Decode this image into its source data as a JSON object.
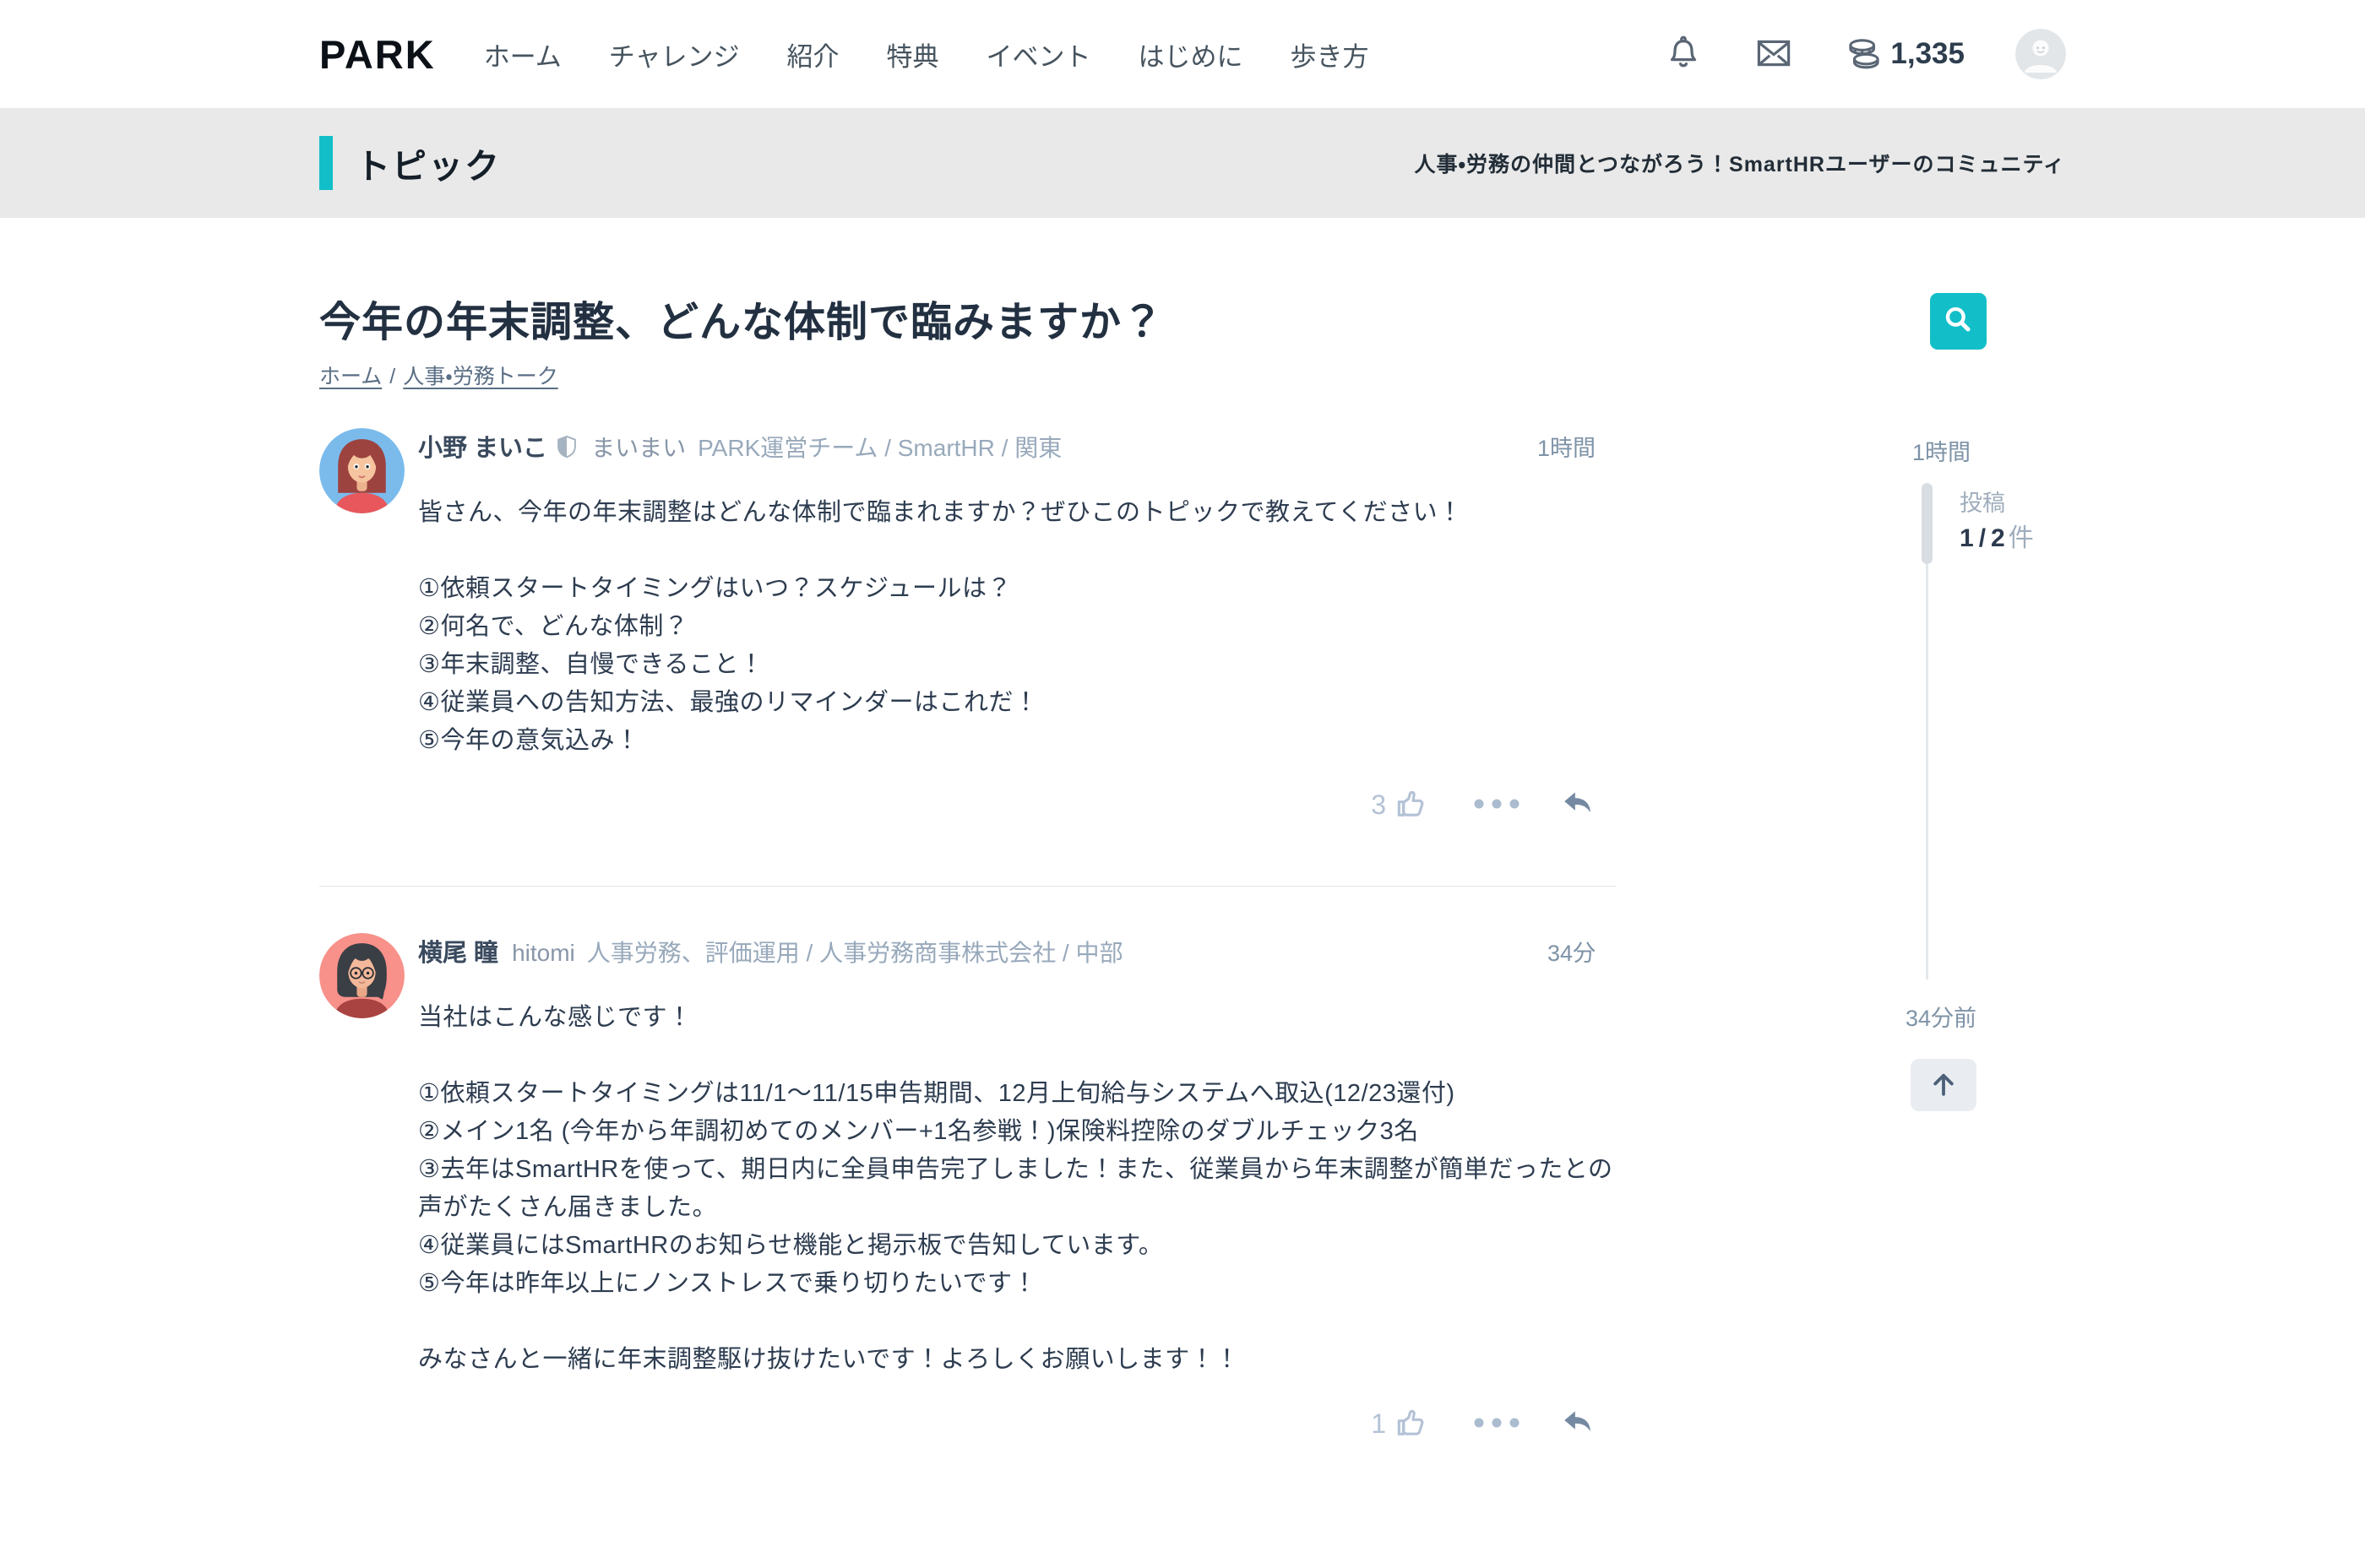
{
  "colors": {
    "accent": "#12bfc9",
    "topicbar_bg": "#e9e9e9"
  },
  "header": {
    "logo": "PARK",
    "nav": [
      "ホーム",
      "チャレンジ",
      "紹介",
      "特典",
      "イベント",
      "はじめに",
      "歩き方"
    ],
    "coin_count": "1,335"
  },
  "topicbar": {
    "label": "トピック",
    "tagline": "人事・労務の仲間とつながろう！SmartHRユーザーのコミュニティ"
  },
  "page": {
    "title": "今年の年末調整、どんな体制で臨みますか？",
    "breadcrumbs": [
      {
        "label": "ホーム"
      },
      {
        "label": "人事・労務トーク"
      }
    ],
    "breadcrumb_separator": "/"
  },
  "posts": [
    {
      "author": "小野 まいこ",
      "nickname": "まいまい",
      "meta": "PARK運営チーム / SmartHR / 関東",
      "time": "1時間",
      "likes": "3",
      "body": "皆さん、今年の年末調整はどんな体制で臨まれますか？ぜひこのトピックで教えてください！\n\n①依頼スタートタイミングはいつ？スケジュールは？\n②何名で、どんな体制？\n③年末調整、自慢できること！\n④従業員への告知方法、最強のリマインダーはこれだ！\n⑤今年の意気込み！"
    },
    {
      "author": "横尾 瞳",
      "nickname": "hitomi",
      "meta": "人事労務、評価運用 / 人事労務商事株式会社 / 中部",
      "time": "34分",
      "likes": "1",
      "body": "当社はこんな感じです！\n\n①依頼スタートタイミングは11/1〜11/15申告期間、12月上旬給与システムへ取込(12/23還付)\n②メイン1名 (今年から年調初めてのメンバー+1名参戦！)保険料控除のダブルチェック3名\n③去年はSmartHRを使って、期日内に全員申告完了しました！また、従業員から年末調整が簡単だったとの声がたくさん届きました。\n④従業員にはSmartHRのお知らせ機能と掲示板で告知しています。\n⑤今年は昨年以上にノンストレスで乗り切りたいです！\n\nみなさんと一緒に年末調整駆け抜けたいです！よろしくお願いします！！"
    }
  ],
  "sidebar": {
    "top_time": "1時間",
    "posts_label": "投稿",
    "count_current": "1",
    "count_separator": "/",
    "count_total": "2",
    "count_unit": "件",
    "bottom_time": "34分前"
  }
}
